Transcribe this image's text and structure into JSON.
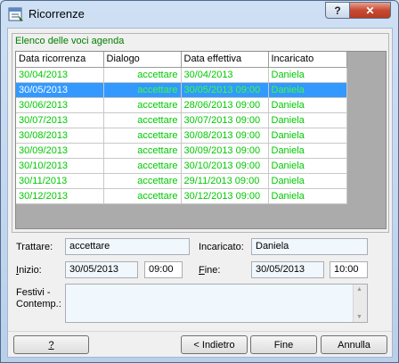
{
  "window": {
    "title": "Ricorrenze"
  },
  "titlebar": {
    "help_glyph": "?",
    "close_glyph": "✕"
  },
  "group": {
    "label": "Elenco delle voci agenda"
  },
  "table": {
    "headers": [
      "Data ricorrenza",
      "Dialogo",
      "Data effettiva",
      "Incaricato"
    ],
    "rows": [
      [
        "30/04/2013",
        "accettare",
        "30/04/2013",
        "Daniela"
      ],
      [
        "30/05/2013",
        "accettare",
        "30/05/2013 09:00",
        "Daniela"
      ],
      [
        "30/06/2013",
        "accettare",
        "28/06/2013 09:00",
        "Daniela"
      ],
      [
        "30/07/2013",
        "accettare",
        "30/07/2013 09:00",
        "Daniela"
      ],
      [
        "30/08/2013",
        "accettare",
        "30/08/2013 09:00",
        "Daniela"
      ],
      [
        "30/09/2013",
        "accettare",
        "30/09/2013 09:00",
        "Daniela"
      ],
      [
        "30/10/2013",
        "accettare",
        "30/10/2013 09:00",
        "Daniela"
      ],
      [
        "30/11/2013",
        "accettare",
        "29/11/2013 09:00",
        "Daniela"
      ],
      [
        "30/12/2013",
        "accettare",
        "30/12/2013 09:00",
        "Daniela"
      ]
    ],
    "selected_row": 1
  },
  "form": {
    "trattare_label": "Trattare:",
    "trattare_value": "accettare",
    "incaricato_label": "Incaricato:",
    "incaricato_value": "Daniela",
    "inizio_label_first": "I",
    "inizio_label_rest": "nizio:",
    "inizio_date": "30/05/2013",
    "inizio_time": "09:00",
    "fine_label_first": "F",
    "fine_label_rest": "ine:",
    "fine_date": "30/05/2013",
    "fine_time": "10:00",
    "festivi_label_line1": "Festivi -",
    "festivi_label_line2": "Contemp.:"
  },
  "buttons": {
    "help": "?",
    "back": "< Indietro",
    "finish": "Fine",
    "cancel": "Annulla"
  },
  "colors": {
    "grid_text": "#00c800",
    "selection": "#3399ff",
    "group_label": "#008000"
  }
}
